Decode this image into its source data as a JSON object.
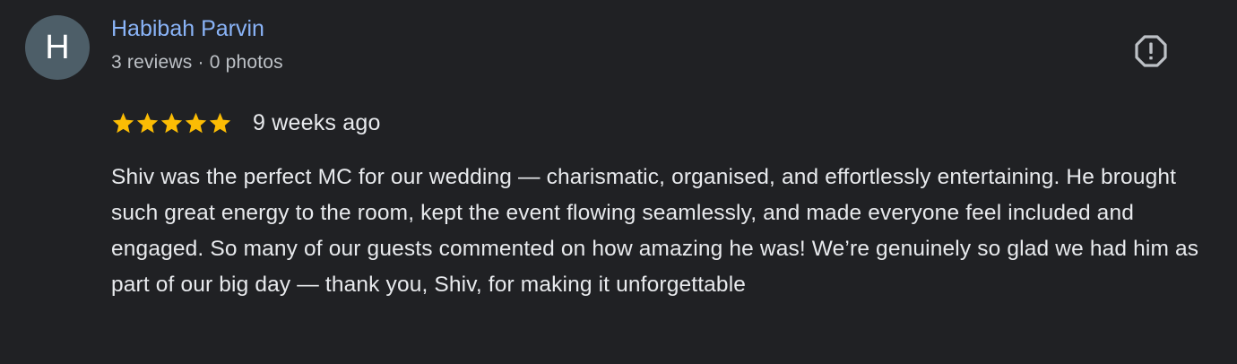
{
  "review": {
    "author": {
      "avatar_initial": "H",
      "name": "Habibah Parvin",
      "reviews_count": "3 reviews",
      "separator": "·",
      "photos_count": "0 photos"
    },
    "rating": {
      "stars": 5,
      "max_stars": 5,
      "star_color": "#fbbc04"
    },
    "date": "9 weeks ago",
    "text": "Shiv was the perfect MC for our wedding — charismatic, organised, and effortlessly entertaining. He brought such great energy to the room, kept the event flowing seamlessly, and made everyone feel included and engaged. So many of our guests commented on how amazing he was! We’re genuinely so glad we had him as part of our big day — thank you, Shiv, for making it unforgettable",
    "report_icon": "report-flag-icon"
  },
  "colors": {
    "background": "#202124",
    "name_link": "#8ab4f8",
    "avatar_bg": "#4d5e68",
    "meta_text": "#bdc1c6",
    "body_text": "#e8eaed"
  }
}
